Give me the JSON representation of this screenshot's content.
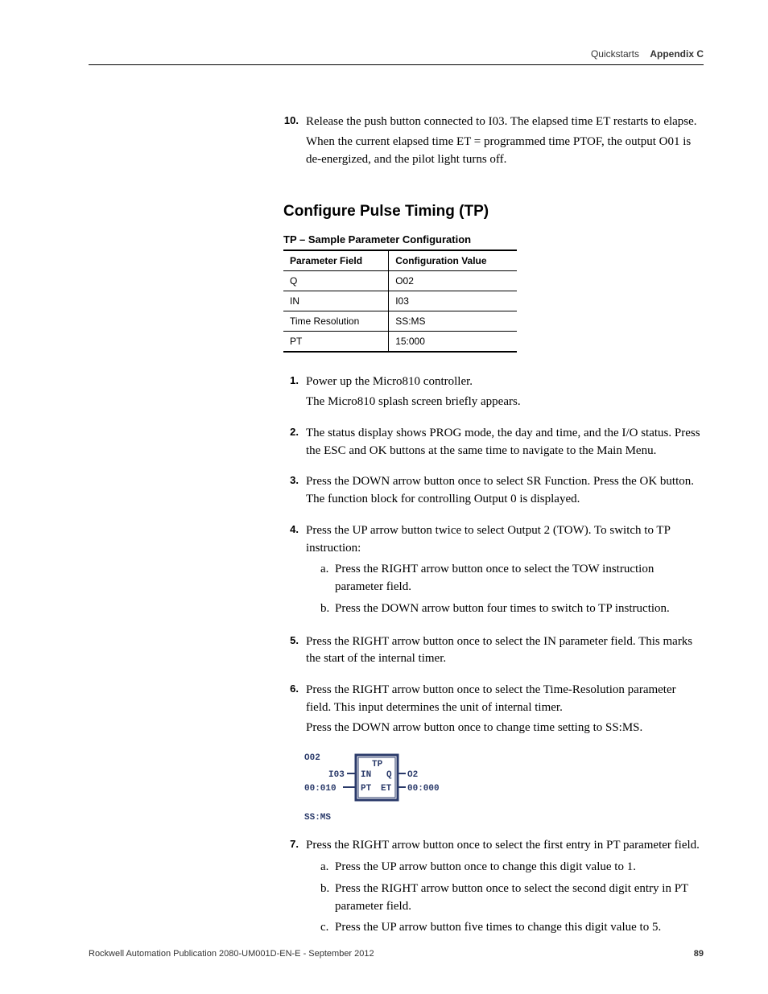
{
  "header": {
    "section": "Quickstarts",
    "appendix": "Appendix C"
  },
  "prev_step": {
    "num": "10.",
    "p1": "Release the push button connected to I03. The elapsed time ET restarts to elapse.",
    "p2": "When the current elapsed time ET = programmed time PTOF, the output O01 is de-energized, and the pilot light turns off."
  },
  "section_title": "Configure Pulse Timing (TP)",
  "table_title": "TP – Sample Parameter Configuration",
  "table": {
    "h1": "Parameter Field",
    "h2": "Configuration Value",
    "rows": [
      {
        "f": "Q",
        "v": "O02"
      },
      {
        "f": "IN",
        "v": "I03"
      },
      {
        "f": "Time Resolution",
        "v": "SS:MS"
      },
      {
        "f": "PT",
        "v": "15:000"
      }
    ]
  },
  "steps": [
    {
      "n": "1.",
      "p1": "Power up the Micro810 controller.",
      "p2": "The Micro810 splash screen briefly appears."
    },
    {
      "n": "2.",
      "p1": "The status display shows PROG mode, the day and time, and the I/O status. Press the ESC and OK buttons at the same time to navigate to the Main Menu."
    },
    {
      "n": "3.",
      "p1": "Press the DOWN arrow button once to select SR Function. Press the OK button. The function block for controlling Output 0 is displayed."
    },
    {
      "n": "4.",
      "p1": "Press the UP arrow button twice to select Output 2 (TOW). To switch to TP instruction:",
      "subs": [
        {
          "l": "a.",
          "t": "Press the RIGHT arrow button once to select the TOW instruction parameter field."
        },
        {
          "l": "b.",
          "t": "Press the DOWN arrow button four times to switch to TP instruction."
        }
      ]
    },
    {
      "n": "5.",
      "p1": "Press the RIGHT arrow button once to select the IN parameter field. This marks the start of the internal timer."
    },
    {
      "n": "6.",
      "p1": "Press the RIGHT arrow button once to select the Time-Resolution parameter field. This input determines the unit of internal timer.",
      "p2": "Press the DOWN arrow button once to change time setting to SS:MS."
    },
    {
      "n": "7.",
      "p1": "Press the RIGHT arrow button once to select the first entry in PT parameter field.",
      "subs": [
        {
          "l": "a.",
          "t": "Press the UP arrow button once to change this digit value to 1."
        },
        {
          "l": "b.",
          "t": "Press the RIGHT arrow button once to select the second digit entry in PT parameter field."
        },
        {
          "l": "c.",
          "t": "Press the UP arrow button five times to change this digit value to 5."
        }
      ]
    }
  ],
  "lcd": {
    "line1": "O02",
    "in_left": "I03",
    "pt_left": "00:010",
    "block_top": "TP",
    "block_in": "IN",
    "block_q": "Q",
    "block_pt": "PT",
    "block_et": "ET",
    "out_right": "O2",
    "et_right": "00:000",
    "bottom": "SS:MS"
  },
  "footer": {
    "pub": "Rockwell Automation Publication 2080-UM001D-EN-E - September 2012",
    "page": "89"
  }
}
